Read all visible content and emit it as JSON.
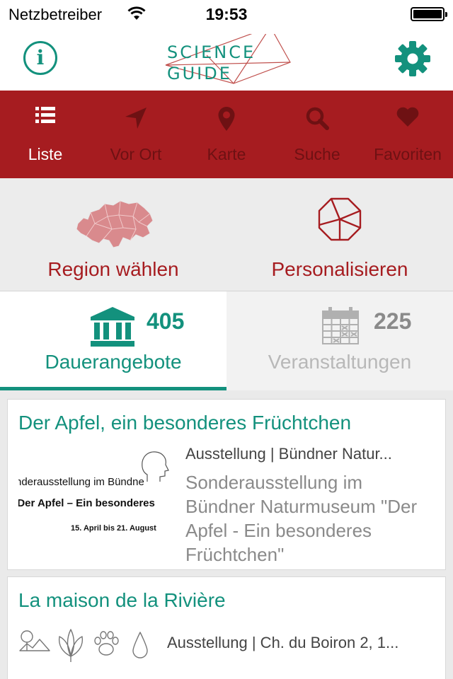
{
  "status_bar": {
    "carrier": "Netzbetreiber",
    "time": "19:53"
  },
  "header": {
    "logo_line1": "SCIENCE",
    "logo_line2": "GUIDE",
    "info_icon": "info-icon",
    "settings_icon": "gear-icon"
  },
  "colors": {
    "brand_red": "#a61c20",
    "brand_green": "#13917d",
    "inactive_tab_text": "#6e1113"
  },
  "tabs": [
    {
      "label": "Liste",
      "icon": "list-icon",
      "active": true
    },
    {
      "label": "Vor Ort",
      "icon": "location-arrow-icon",
      "active": false
    },
    {
      "label": "Karte",
      "icon": "map-pin-icon",
      "active": false
    },
    {
      "label": "Suche",
      "icon": "search-icon",
      "active": false
    },
    {
      "label": "Favoriten",
      "icon": "heart-icon",
      "active": false
    }
  ],
  "choices": {
    "region": {
      "label": "Region wählen",
      "icon": "switzerland-map-icon"
    },
    "personalize": {
      "label": "Personalisieren",
      "icon": "polygon-wheel-icon"
    }
  },
  "segments": {
    "permanent": {
      "label": "Dauerangebote",
      "count": "405",
      "icon": "museum-icon",
      "selected": true
    },
    "events": {
      "label": "Veranstaltungen",
      "count": "225",
      "icon": "calendar-icon",
      "selected": false
    }
  },
  "items": [
    {
      "title": "Der Apfel, ein besonderes Früchtchen",
      "meta": "Ausstellung | Bündner Natur...",
      "description": "Sonderausstellung im Bündner Naturmuseum \"Der Apfel - Ein besonderes Früchtchen\"",
      "thumbnail": {
        "line1": "nderausstellung im Bündne",
        "line2": "«Der Apfel – Ein besonderes",
        "line3": "15. April bis 21. August"
      }
    },
    {
      "title": "La maison de la Rivière",
      "meta": "Ausstellung | Ch. du Boiron 2, 1...",
      "category_icons": [
        "landscape-icon",
        "leaves-icon",
        "paw-icon",
        "water-drop-icon"
      ]
    }
  ]
}
